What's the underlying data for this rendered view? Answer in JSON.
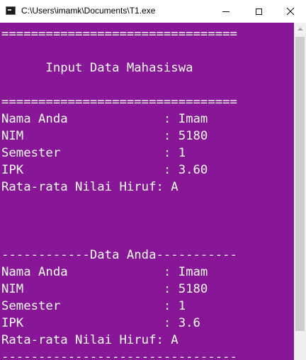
{
  "window": {
    "title": "C:\\Users\\imamk\\Documents\\T1.exe",
    "controls": {
      "minimize": "minimize",
      "maximize": "maximize",
      "close": "close"
    }
  },
  "console": {
    "background_color": "#881798",
    "text_color": "#ffffff",
    "lines": [
      "================================",
      "",
      "      Input Data Mahasiswa",
      "",
      "================================",
      "Nama Anda             : Imam",
      "NIM                   : 5180",
      "Semester              : 1",
      "IPK                   : 3.60",
      "Rata-rata Nilai Hiruf: A",
      "",
      "",
      "",
      "------------Data Anda-----------",
      "Nama Anda             : Imam",
      "NIM                   : 5180",
      "Semester              : 1",
      "IPK                   : 3.6",
      "Rata-rata Nilai Hiruf: A",
      "--------------------------------"
    ]
  },
  "icons": {
    "app": "console-app-icon",
    "minimize": "minimize-icon",
    "maximize": "maximize-icon",
    "close": "close-icon",
    "scroll_up": "arrow-up-icon"
  }
}
